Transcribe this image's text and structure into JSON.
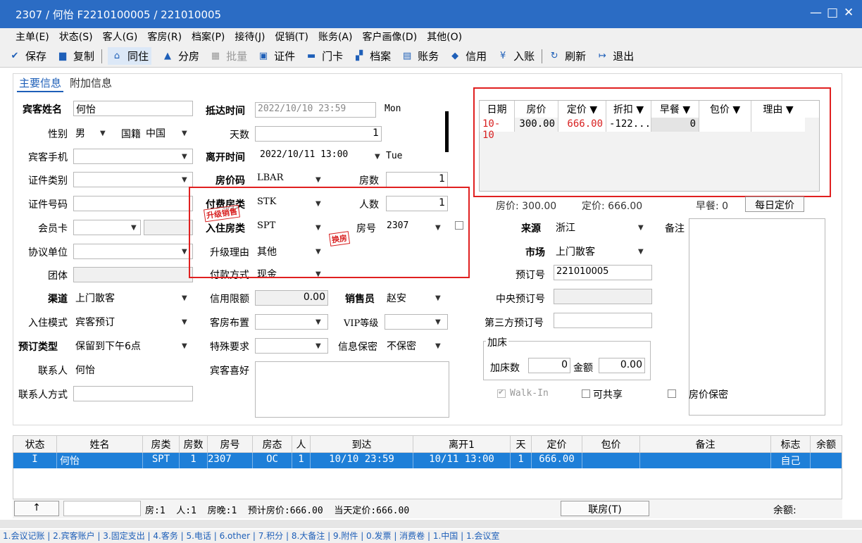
{
  "window": {
    "title": "2307 / 何怡 F2210100005 / 221010005",
    "minimize": "—",
    "maximize": "□",
    "close": "✕"
  },
  "menu": [
    "主单(E)",
    "状态(S)",
    "客人(G)",
    "客房(R)",
    "档案(P)",
    "接待(J)",
    "促销(T)",
    "账务(A)",
    "客户画像(D)",
    "其他(O)"
  ],
  "toolbar": {
    "save": "保存",
    "copy": "复制",
    "share": "同住",
    "split": "分房",
    "batch": "批量",
    "cert": "证件",
    "card": "门卡",
    "archive": "档案",
    "account": "账务",
    "credit": "信用",
    "post": "入账",
    "refresh": "刷新",
    "exit": "退出"
  },
  "tabs": {
    "main": "主要信息",
    "extra": "附加信息"
  },
  "form": {
    "guest_name_label": "宾客姓名",
    "guest_name": "何怡",
    "gender_label": "性别",
    "gender": "男",
    "nation_label": "国籍",
    "nation": "中国",
    "phone_label": "宾客手机",
    "phone": "",
    "cert_type_label": "证件类别",
    "cert_type": "",
    "cert_no_label": "证件号码",
    "cert_no": "",
    "member_label": "会员卡",
    "member": "",
    "agreement_label": "协议单位",
    "agreement": "",
    "group_label": "团体",
    "group": "",
    "channel_label": "渠道",
    "channel": "上门散客",
    "mode_label": "入住模式",
    "mode": "宾客预订",
    "res_type_label": "预订类型",
    "res_type": "保留到下午6点",
    "contact_label": "联系人",
    "contact": "何怡",
    "contact_way_label": "联系人方式",
    "contact_way": "",
    "arrive_label": "抵达时间",
    "arrive": "2022/10/10 23:59",
    "arrive_day": "Mon",
    "days_label": "天数",
    "days": "1",
    "leave_label": "离开时间",
    "leave": "2022/10/11 13:00",
    "leave_day": "Tue",
    "rate_code_label": "房价码",
    "rate_code": "LBAR",
    "rooms_label": "房数",
    "rooms": "1",
    "pay_type_label": "付费房类",
    "pay_type": "STK",
    "persons_label": "人数",
    "persons": "1",
    "stay_type_label": "入住房类",
    "stay_type": "SPT",
    "room_no_label": "房号",
    "room_no": "2307",
    "upgrade_reason_label": "升级理由",
    "upgrade_reason": "其他",
    "pay_method_label": "付款方式",
    "pay_method": "现金",
    "credit_label": "信用限额",
    "credit": "0.00",
    "sales_label": "销售员",
    "sales": "赵安",
    "layout_label": "客房布置",
    "layout": "",
    "vip_label": "VIP等级",
    "vip": "",
    "special_label": "特殊要求",
    "special": "",
    "secret_label": "信息保密",
    "secret": "不保密",
    "preference_label": "宾客喜好",
    "preference": "",
    "upsell_stamp": "升级销售",
    "change_stamp": "换房"
  },
  "rate_table": {
    "headers": [
      "日期",
      "房价",
      "定价 ▼",
      "折扣 ▼",
      "早餐 ▼",
      "包价 ▼",
      "理由 ▼"
    ],
    "row": [
      "10-10",
      "300.00",
      "666.00",
      "-122...",
      "0",
      "",
      ""
    ]
  },
  "rate_summary": {
    "price": "房价: 300.00",
    "fixed": "定价: 666.00",
    "breakfast": "早餐: 0",
    "daily_btn": "每日定价"
  },
  "right": {
    "source_label": "来源",
    "source": "浙江",
    "market_label": "市场",
    "market": "上门散客",
    "res_no_label": "预订号",
    "res_no": "221010005",
    "central_label": "中央预订号",
    "central": "",
    "third_label": "第三方预订号",
    "third": "",
    "remark_label": "备注",
    "extra_bed_title": "加床",
    "extra_bed_label": "加床数",
    "extra_bed": "0",
    "amount_label": "金额",
    "amount": "0.00",
    "walkin": "Walk-In",
    "shareable": "可共享",
    "rate_secret": "房价保密"
  },
  "grid": {
    "headers": [
      "状态",
      "姓名",
      "房类",
      "房数",
      "房号",
      "房态",
      "人",
      "到达",
      "离开1",
      "天",
      "定价",
      "包价",
      "备注",
      "标志",
      "余额"
    ],
    "row": [
      "I",
      "何怡",
      "SPT",
      "1",
      "2307",
      "OC",
      "1",
      "10/10 23:59",
      "10/11 13:00",
      "1",
      "666.00",
      "",
      "",
      "自己",
      ""
    ]
  },
  "status": {
    "up_btn": "↑",
    "summary": "房:1  人:1  房晚:1  预计房价:666.00  当天定价:666.00",
    "link_btn": "联房(T)",
    "balance": "余额:"
  },
  "bottom_tabs": "1.会议记账 | 2.宾客账户 | 3.固定支出 | 4.客务 | 5.电话 | 6.other | 7.积分 | 8.大备注 | 9.附件 | 0.发票 | 消费卷 | 1.中国 | 1.会议室"
}
